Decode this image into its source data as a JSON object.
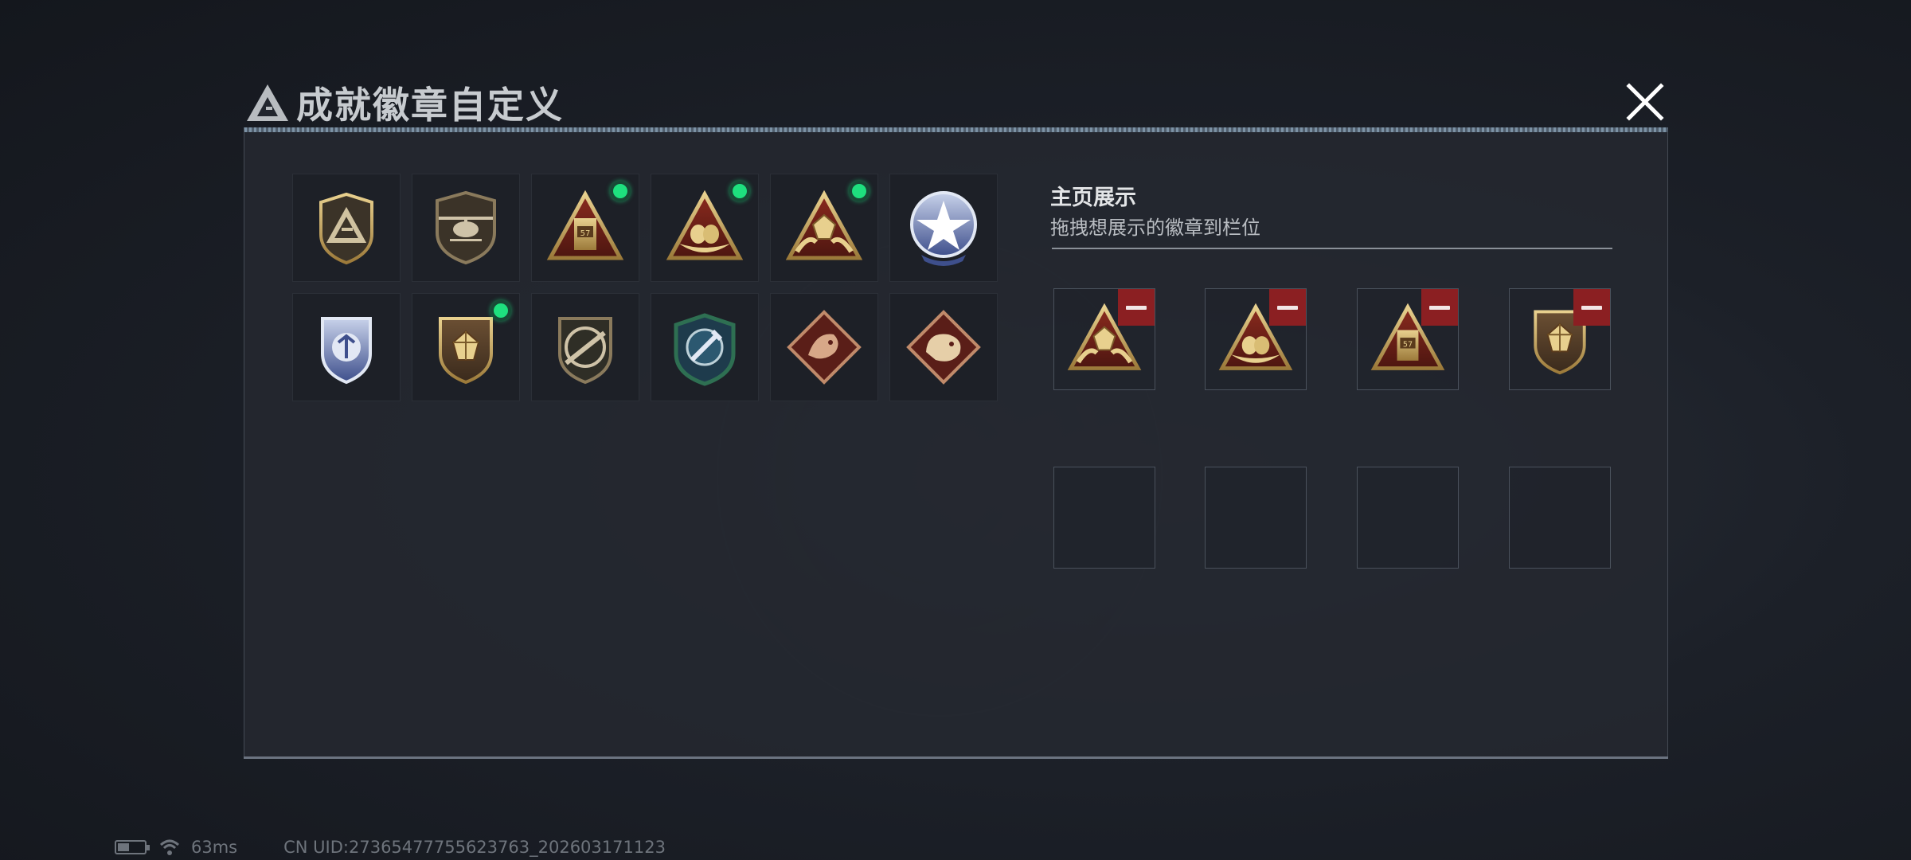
{
  "dialog": {
    "title": "成就徽章自定义"
  },
  "badges": [
    {
      "name": "triangle-shield-badge",
      "equipped": false
    },
    {
      "name": "helicopter-badge",
      "equipped": false
    },
    {
      "name": "ammo-triangle-badge",
      "equipped": true
    },
    {
      "name": "nest-triangle-badge",
      "equipped": true
    },
    {
      "name": "gem-hands-triangle-badge",
      "equipped": true
    },
    {
      "name": "star-round-badge",
      "equipped": false
    },
    {
      "name": "blue-shield-badge",
      "equipped": false
    },
    {
      "name": "gem-shield-badge",
      "equipped": true
    },
    {
      "name": "rifle-shield-badge",
      "equipped": false
    },
    {
      "name": "sword-green-shield-badge",
      "equipped": false
    },
    {
      "name": "dragon-diamond-badge",
      "equipped": false
    },
    {
      "name": "serpent-diamond-badge",
      "equipped": false
    }
  ],
  "showcase": {
    "title": "主页展示",
    "subtitle": "拖拽想展示的徽章到栏位",
    "slots": [
      {
        "badge": "gem-hands-triangle-badge"
      },
      {
        "badge": "nest-triangle-badge"
      },
      {
        "badge": "ammo-triangle-badge"
      },
      {
        "badge": "gem-shield-badge"
      },
      {
        "badge": ""
      },
      {
        "badge": ""
      },
      {
        "badge": ""
      },
      {
        "badge": ""
      }
    ]
  },
  "status": {
    "ping": "63ms",
    "uid": "CN UID:27365477755623763_202603171123"
  },
  "colors": {
    "equipped_dot": "#1ee07e",
    "remove_button": "#8b1f22",
    "gold": "#c9a862"
  }
}
